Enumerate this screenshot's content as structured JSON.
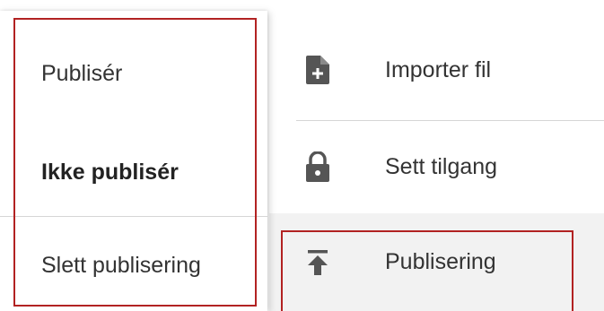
{
  "publish_popup": {
    "items": [
      {
        "label": "Publisér"
      },
      {
        "label": "Ikke publisér"
      },
      {
        "label": "Slett publisering"
      }
    ]
  },
  "main_menu": {
    "items": [
      {
        "label": "Importer fil",
        "icon": "file-add-icon"
      },
      {
        "label": "Sett tilgang",
        "icon": "lock-icon"
      },
      {
        "label": "Publisering",
        "icon": "publish-upload-icon"
      }
    ]
  },
  "colors": {
    "highlight": "#b22222",
    "icon": "#555555",
    "active_background": "#f2f2f2"
  }
}
